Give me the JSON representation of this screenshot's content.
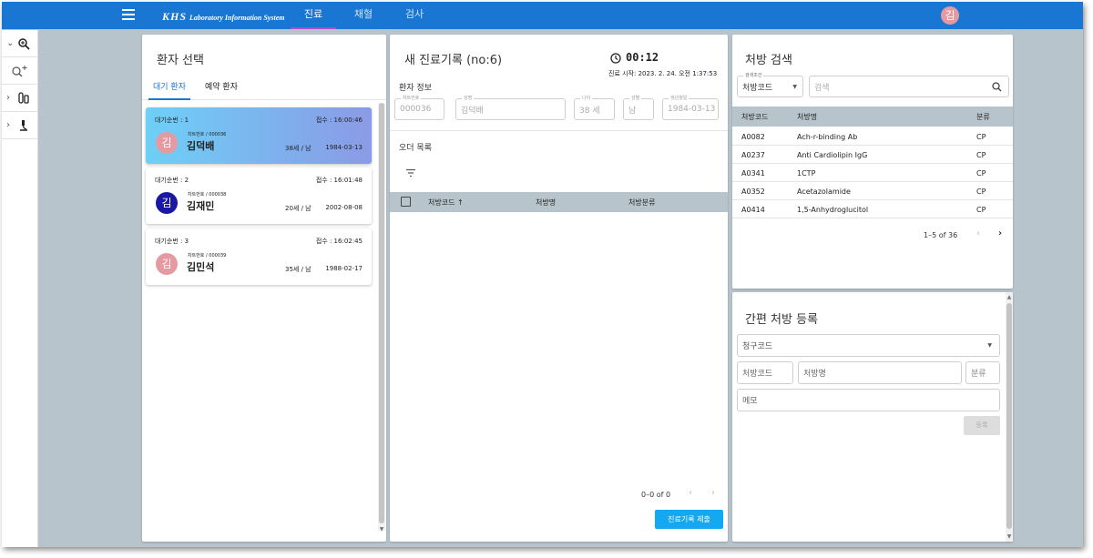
{
  "topbar": {
    "logo_mark": "KHS",
    "logo_text": "Laboratory Information System",
    "nav": [
      "진료",
      "채혈",
      "검사"
    ],
    "active_nav": 0,
    "avatar_initial": "김"
  },
  "patient_select": {
    "title": "환자 선택",
    "tabs": [
      "대기 환자",
      "예약 환자"
    ],
    "patients": [
      {
        "order": "대기순번 : 1",
        "reception": "접수 : 16:00:46",
        "chart_no": "차트번호 / 000036",
        "name": "김덕배",
        "initial": "김",
        "age_sex": "38세 / 남",
        "birth": "1984-03-13",
        "avatar_color": "#e49aa0"
      },
      {
        "order": "대기순번 : 2",
        "reception": "접수 : 16:01:48",
        "chart_no": "차트번호 / 000038",
        "name": "김재민",
        "initial": "김",
        "age_sex": "20세 / 남",
        "birth": "2002-08-08",
        "avatar_color": "#1a17a4"
      },
      {
        "order": "대기순번 : 3",
        "reception": "접수 : 16:02:45",
        "chart_no": "차트번호 / 000039",
        "name": "김민석",
        "initial": "김",
        "age_sex": "35세 / 남",
        "birth": "1988-02-17",
        "avatar_color": "#e49aa0"
      }
    ]
  },
  "record": {
    "title": "새 진료기록 (no:6)",
    "timer": "00:12",
    "start": "진료 시작: 2023. 2. 24. 오전 1:37:53",
    "patient_info_label": "환자 정보",
    "fields": [
      {
        "label": "차트번호",
        "value": "000036"
      },
      {
        "label": "성명",
        "value": "김덕배"
      },
      {
        "label": "나이",
        "value": "38 세"
      },
      {
        "label": "성별",
        "value": "남"
      },
      {
        "label": "생년월일",
        "value": "1984-03-13"
      }
    ],
    "order_list_label": "오더 목록",
    "columns": [
      "처방코드 ↑",
      "처방명",
      "처방분류"
    ],
    "pagination": "0–0 of 0",
    "submit_label": "진료기록 제출"
  },
  "rx_search": {
    "title": "처방 검색",
    "condition_label": "검색조건",
    "condition_value": "처방코드",
    "search_placeholder": "검색",
    "columns": [
      "처방코드",
      "처방명",
      "분류"
    ],
    "rows": [
      {
        "code": "A0082",
        "name": "Ach-r-binding Ab",
        "cls": "CP"
      },
      {
        "code": "A0237",
        "name": "Anti Cardiolipin IgG",
        "cls": "CP"
      },
      {
        "code": "A0341",
        "name": "1CTP",
        "cls": "CP"
      },
      {
        "code": "A0352",
        "name": "Acetazolamide",
        "cls": "CP"
      },
      {
        "code": "A0414",
        "name": "1,5-Anhydroglucitol",
        "cls": "CP"
      }
    ],
    "pagination": "1–5 of 36"
  },
  "quick_rx": {
    "title": "간편 처방 등록",
    "claim_code": "청구코드",
    "rx_code": "처방코드",
    "rx_name": "처방명",
    "category": "분류",
    "memo": "메모",
    "register_label": "등록"
  }
}
